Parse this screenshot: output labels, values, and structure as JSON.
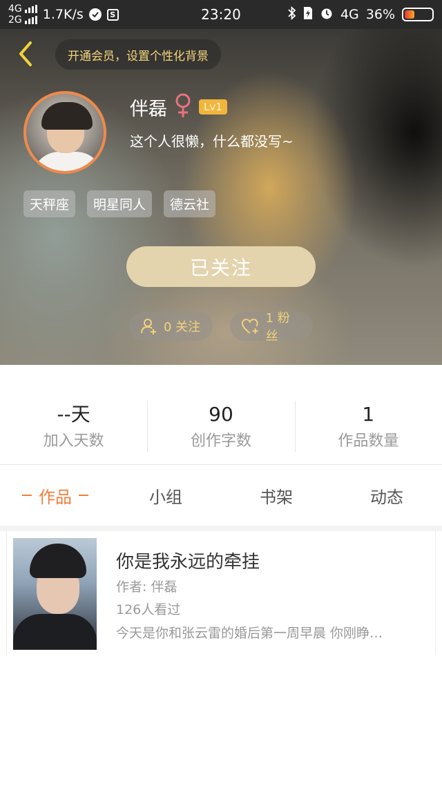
{
  "status_bar": {
    "net_top": "4G",
    "net_bottom": "2G",
    "speed": "1.7K/s",
    "time": "23:20",
    "net_right": "4G",
    "battery": "36%",
    "battery_level": 0.36
  },
  "header": {
    "vip_promo": "开通会员，设置个性化背景",
    "name": "伴磊",
    "gender_symbol": "♀",
    "level": "Lv1",
    "bio": "这个人很懒，什么都没写~",
    "tags": [
      "天秤座",
      "明星同人",
      "德云社"
    ],
    "follow_button": "已关注",
    "following": "0 关注",
    "fans": "1 粉丝"
  },
  "stats": [
    {
      "value": "--天",
      "label": "加入天数"
    },
    {
      "value": "90",
      "label": "创作字数"
    },
    {
      "value": "1",
      "label": "作品数量"
    }
  ],
  "tabs": [
    {
      "label": "作品",
      "active": true
    },
    {
      "label": "小组",
      "active": false
    },
    {
      "label": "书架",
      "active": false
    },
    {
      "label": "动态",
      "active": false
    }
  ],
  "works": [
    {
      "title": "你是我永远的牵挂",
      "author": "作者: 伴磊",
      "views": "126人看过",
      "excerpt": "今天是你和张云雷的婚后第一周早晨 你刚睁…"
    }
  ],
  "colors": {
    "accent": "#f27d3a",
    "gold": "#f2d27a",
    "follow_button": "#e3d4ae",
    "level_badge": "#f2b53c"
  }
}
